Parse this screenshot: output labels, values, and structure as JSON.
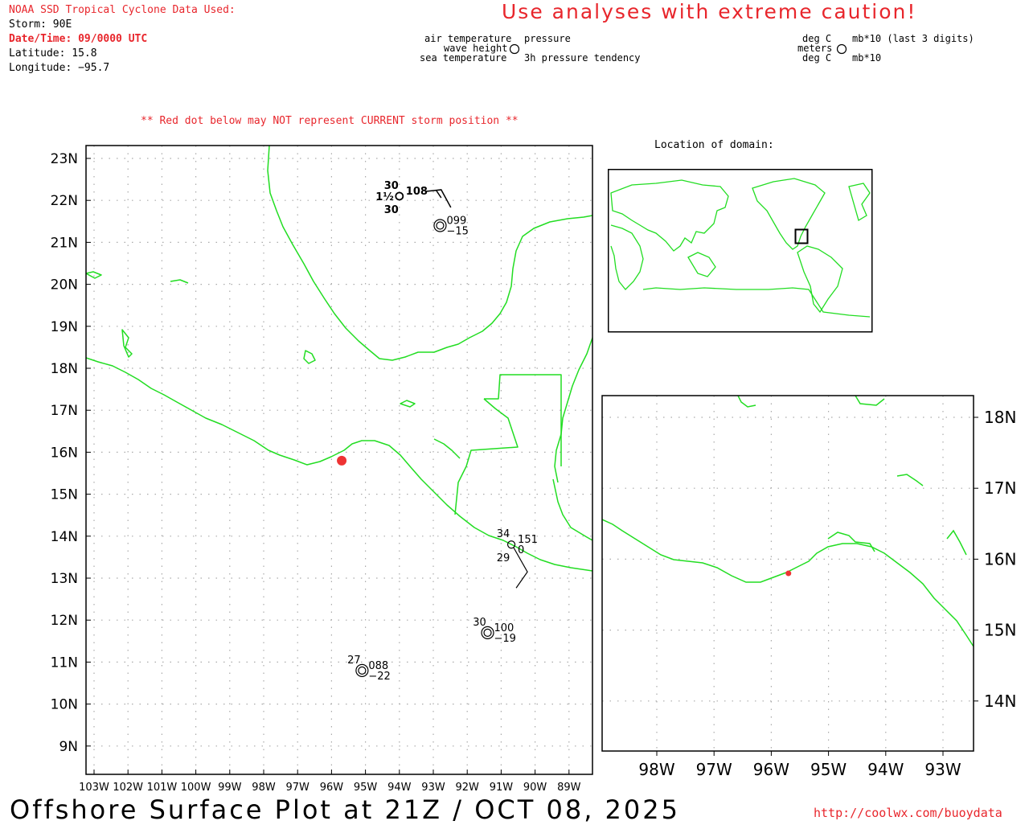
{
  "header": {
    "source_title": "NOAA SSD Tropical Cyclone Data Used:",
    "storm": "Storm: 90E",
    "datetime": "Date/Time: 09/0000 UTC",
    "latitude": "Latitude: 15.8",
    "longitude": "Longitude: −95.7",
    "caution": "Use analyses with extreme caution!",
    "red_dot_note": "** Red dot below may NOT represent CURRENT storm position **",
    "domain_title": "Location of domain:"
  },
  "station_model_legend": {
    "left": {
      "air_temp": "air temperature",
      "wave_height": "wave height",
      "sea_temp": "sea temperature",
      "pressure": "pressure",
      "tendency": "3h pressure tendency"
    },
    "right": {
      "deg_c_1": "deg C",
      "meters": "meters",
      "deg_c_2": "deg C",
      "mb_last3": "mb*10 (last 3 digits)",
      "mb10": "mb*10"
    }
  },
  "main_map": {
    "lat_labels": [
      "23N",
      "22N",
      "21N",
      "20N",
      "19N",
      "18N",
      "17N",
      "16N",
      "15N",
      "14N",
      "13N",
      "12N",
      "11N",
      "10N",
      "9N"
    ],
    "lon_labels": [
      "103W",
      "102W",
      "101W",
      "100W",
      "99W",
      "98W",
      "97W",
      "96W",
      "95W",
      "94W",
      "93W",
      "92W",
      "91W",
      "90W",
      "89W"
    ],
    "storm_position": {
      "lat": 15.8,
      "lon": -95.7
    },
    "observations": [
      {
        "lat": 22.1,
        "lon": -94.0,
        "air_temp": "30",
        "wave_height": "1½",
        "sea_temp": "30",
        "pressure": "108"
      },
      {
        "lat": 21.4,
        "lon": -92.8,
        "pressure": "099",
        "tendency": "−15"
      },
      {
        "lat": 13.8,
        "lon": -90.7,
        "air_temp": "34",
        "sea_temp": "29",
        "pressure": "151",
        "tendency": "0"
      },
      {
        "lat": 11.7,
        "lon": -91.4,
        "air_temp": "30",
        "pressure": "100",
        "tendency": "−19"
      },
      {
        "lat": 10.8,
        "lon": -95.1,
        "air_temp": "27",
        "pressure": "088",
        "tendency": "−22"
      }
    ]
  },
  "zoom_map": {
    "lat_labels": [
      "18N",
      "17N",
      "16N",
      "15N",
      "14N"
    ],
    "lon_labels": [
      "98W",
      "97W",
      "96W",
      "95W",
      "94W",
      "93W"
    ],
    "storm_position": {
      "lat": 15.8,
      "lon": -95.7
    }
  },
  "footer": {
    "title": "Offshore Surface Plot at 21Z / OCT 08, 2025",
    "url": "http://coolwx.com/buoydata"
  },
  "colors": {
    "coastline": "#22dd22",
    "storm_dot": "#ee3333",
    "alert_text": "#e8262c"
  }
}
